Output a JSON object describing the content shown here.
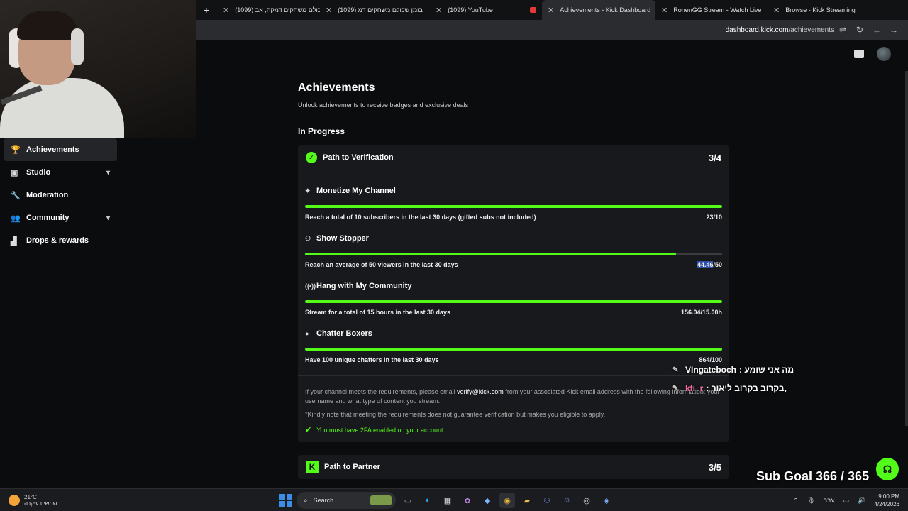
{
  "browser": {
    "tabs": [
      {
        "label": "(1099) כולם משחקים דמקה, אב",
        "fav": "yt"
      },
      {
        "label": "(1099) בומן שכולם משחקים דמ",
        "fav": "yt"
      },
      {
        "label": "(1099) YouTube",
        "fav": "yt"
      },
      {
        "label": "Achievements - Kick Dashboard",
        "fav": "kick"
      },
      {
        "label": "RonenGG Stream - Watch Live",
        "fav": "kick"
      },
      {
        "label": "Browse - Kick Streaming",
        "fav": "kick"
      }
    ],
    "url_domain": "dashboard.kick.com",
    "url_path": "/achievements"
  },
  "sidebar": {
    "items": [
      {
        "label": "Achievements",
        "icon": "trophy-icon"
      },
      {
        "label": "Studio",
        "icon": "video-icon"
      },
      {
        "label": "Moderation",
        "icon": "wrench-icon"
      },
      {
        "label": "Community",
        "icon": "users-icon"
      },
      {
        "label": "Drops & rewards",
        "icon": "chart-icon"
      }
    ]
  },
  "page": {
    "title": "Achievements",
    "subtitle": "Unlock achievements to receive badges and exclusive deals",
    "section": "In Progress"
  },
  "verification": {
    "title": "Path to Verification",
    "count": "3/4",
    "achievements": [
      {
        "name": "Monetize My Channel",
        "icon": "sparkle-icon",
        "desc": "Reach a total of 10 subscribers in the last 30 days (gifted subs not included)",
        "value": "23/10",
        "progress": 1.0
      },
      {
        "name": "Show Stopper",
        "icon": "viewers-icon",
        "desc": "Reach an average of 50 viewers in the last 30 days",
        "value_hl": "44.46",
        "value_rest": "/50",
        "progress": 0.889
      },
      {
        "name": "Hang with My Community",
        "icon": "broadcast-icon",
        "desc": "Stream for a total of 15 hours in the last 30 days",
        "value": "156.04/15.00h",
        "progress": 1.0
      },
      {
        "name": "Chatter Boxers",
        "icon": "chat-icon",
        "desc": "Have 100 unique chatters in the last 30 days",
        "value": "864/100",
        "progress": 1.0
      }
    ],
    "info_pre": "If your channel meets the requirements, please email",
    "info_email": "verify@kick.com",
    "info_post": "from your associated Kick email address with the following information: your username and what type of content you stream.",
    "note": "*Kindly note that meeting the requirements does not guarantee verification but makes you eligible to apply.",
    "twofa": "You must have 2FA enabled on your account"
  },
  "partner": {
    "title": "Path to Partner",
    "count": "3/5"
  },
  "overlay": {
    "chat": [
      {
        "user": "VIngateboch",
        "msg": ": מה אני שומע"
      },
      {
        "user": "kfi_r",
        "msg": ": בקרוב בקרוב ליאור,"
      }
    ],
    "sub_goal": "Sub Goal 366 / 365"
  },
  "taskbar": {
    "temp": "21°C",
    "weather": "שמשי בעיקרה",
    "search": "Search",
    "lang": "עבר",
    "time": "9:00 PM",
    "date": "4/24/2026"
  },
  "colors": {
    "accent": "#53fc18",
    "bg": "#0b0c0e",
    "card": "#18191c"
  }
}
